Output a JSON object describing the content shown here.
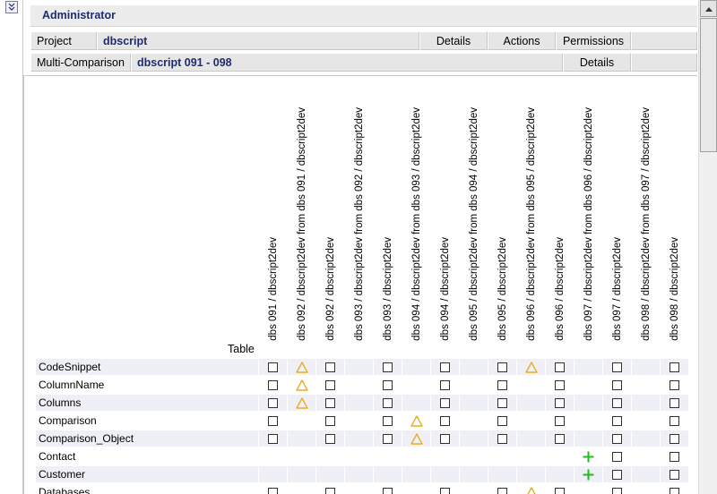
{
  "header": {
    "admin_label": "Administrator"
  },
  "project_row": {
    "label": "Project",
    "value": "dbscript",
    "details": "Details",
    "actions": "Actions",
    "permissions": "Permissions"
  },
  "compare_row": {
    "label": "Multi-Comparison",
    "value": "dbscript 091 - 098",
    "details": "Details"
  },
  "table_header": "Table",
  "columns": [
    "dbs 091 / dbscript2dev",
    "dbs 092 / dbscript2dev from dbs 091 / dbscript2dev",
    "dbs 092 / dbscript2dev",
    "dbs 093 / dbscript2dev from dbs 092 / dbscript2dev",
    "dbs 093 / dbscript2dev",
    "dbs 094 / dbscript2dev from dbs 093 / dbscript2dev",
    "dbs 094 / dbscript2dev",
    "dbs 095 / dbscript2dev from dbs 094 / dbscript2dev",
    "dbs 095 / dbscript2dev",
    "dbs 096 / dbscript2dev from dbs 095 / dbscript2dev",
    "dbs 096 / dbscript2dev",
    "dbs 097 / dbscript2dev from dbs 096 / dbscript2dev",
    "dbs 097 / dbscript2dev",
    "dbs 098 / dbscript2dev from dbs 097 / dbscript2dev",
    "dbs 098 / dbscript2dev"
  ],
  "rows": [
    {
      "name": "CodeSnippet",
      "cells": [
        "check",
        "warn",
        "check",
        "",
        "check",
        "",
        "check",
        "",
        "check",
        "warn",
        "check",
        "",
        "check",
        "",
        "check"
      ]
    },
    {
      "name": "ColumnName",
      "cells": [
        "check",
        "warn",
        "check",
        "",
        "check",
        "",
        "check",
        "",
        "check",
        "",
        "check",
        "",
        "check",
        "",
        "check"
      ]
    },
    {
      "name": "Columns",
      "cells": [
        "check",
        "warn",
        "check",
        "",
        "check",
        "",
        "check",
        "",
        "check",
        "",
        "check",
        "",
        "check",
        "",
        "check"
      ]
    },
    {
      "name": "Comparison",
      "cells": [
        "check",
        "",
        "check",
        "",
        "check",
        "warn",
        "check",
        "",
        "check",
        "",
        "check",
        "",
        "check",
        "",
        "check"
      ]
    },
    {
      "name": "Comparison_Object",
      "cells": [
        "check",
        "",
        "check",
        "",
        "check",
        "warn",
        "check",
        "",
        "check",
        "",
        "check",
        "",
        "check",
        "",
        "check"
      ]
    },
    {
      "name": "Contact",
      "cells": [
        "",
        "",
        "",
        "",
        "",
        "",
        "",
        "",
        "",
        "",
        "",
        "plus",
        "check",
        "",
        "check"
      ]
    },
    {
      "name": "Customer",
      "cells": [
        "",
        "",
        "",
        "",
        "",
        "",
        "",
        "",
        "",
        "",
        "",
        "plus",
        "check",
        "",
        "check"
      ]
    },
    {
      "name": "Databases",
      "cells": [
        "check",
        "",
        "check",
        "",
        "check",
        "",
        "check",
        "",
        "check",
        "warn",
        "check",
        "",
        "check",
        "",
        "check"
      ]
    }
  ],
  "icons": {
    "check": "checkbox-icon",
    "warn": "warning-triangle-icon",
    "plus": "added-plus-icon"
  },
  "colors": {
    "accent": "#1f2c6e",
    "warning": "#e8b020",
    "added": "#22bb22",
    "row_shade": "#eef0f6"
  }
}
